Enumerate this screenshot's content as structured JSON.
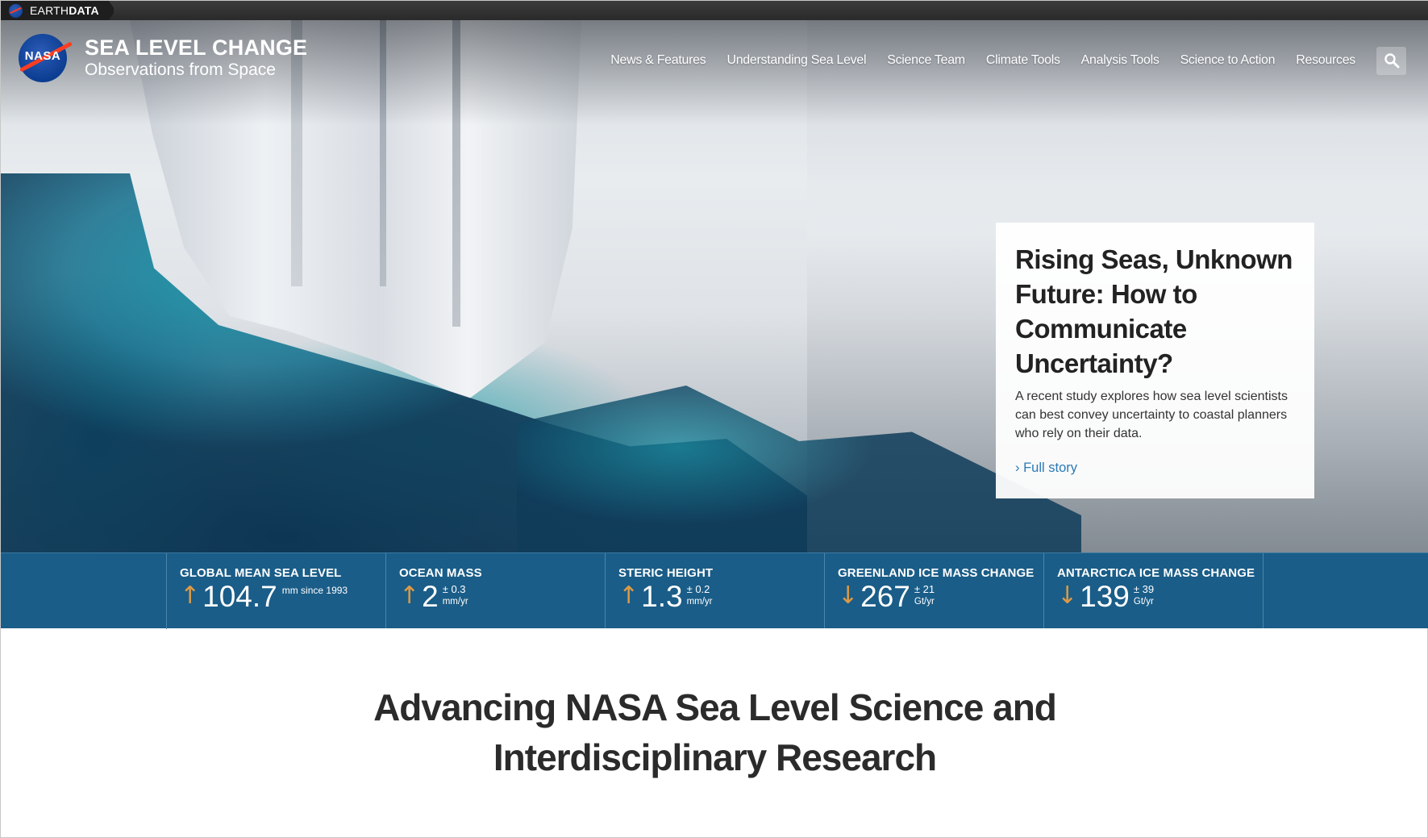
{
  "earthdata_bar": {
    "brand_light": "EARTH",
    "brand_bold": "DATA"
  },
  "header": {
    "logo_text": "NASA",
    "site_title": "SEA LEVEL CHANGE",
    "site_subtitle": "Observations from Space"
  },
  "nav": {
    "items": [
      {
        "label": "News & Features"
      },
      {
        "label": "Understanding Sea Level"
      },
      {
        "label": "Science Team"
      },
      {
        "label": "Climate Tools"
      },
      {
        "label": "Analysis Tools"
      },
      {
        "label": "Science to Action"
      },
      {
        "label": "Resources"
      }
    ],
    "search_icon": "search-icon"
  },
  "feature": {
    "title": "Rising Seas, Unknown Future: How to Communicate Uncertainty?",
    "summary": "A recent study explores how sea level scientists can best convey uncertainty to coastal planners who rely on their data.",
    "link_label": "› Full story"
  },
  "stats": [
    {
      "label": "GLOBAL MEAN SEA LEVEL",
      "direction": "up",
      "arrow": "↑",
      "value": "104.7",
      "note": "mm since 1993"
    },
    {
      "label": "OCEAN MASS",
      "direction": "up",
      "arrow": "↑",
      "value": "2",
      "uncertainty": "± 0.3",
      "unit": "mm/yr"
    },
    {
      "label": "STERIC HEIGHT",
      "direction": "up",
      "arrow": "↑",
      "value": "1.3",
      "uncertainty": "± 0.2",
      "unit": "mm/yr"
    },
    {
      "label": "GREENLAND ICE MASS CHANGE",
      "direction": "down",
      "arrow": "↓",
      "value": "267",
      "uncertainty": "± 21",
      "unit": "Gt/yr"
    },
    {
      "label": "ANTARCTICA ICE MASS CHANGE",
      "direction": "down",
      "arrow": "↓",
      "value": "139",
      "uncertainty": "± 39",
      "unit": "Gt/yr"
    }
  ],
  "main": {
    "heading_line1": "Advancing NASA Sea Level Science and",
    "heading_line2": "Interdisciplinary Research"
  },
  "colors": {
    "stats_bar": "#1a5d88",
    "arrow": "#dd9a45",
    "link": "#2a7ab5",
    "heading": "#2b2b2b"
  }
}
